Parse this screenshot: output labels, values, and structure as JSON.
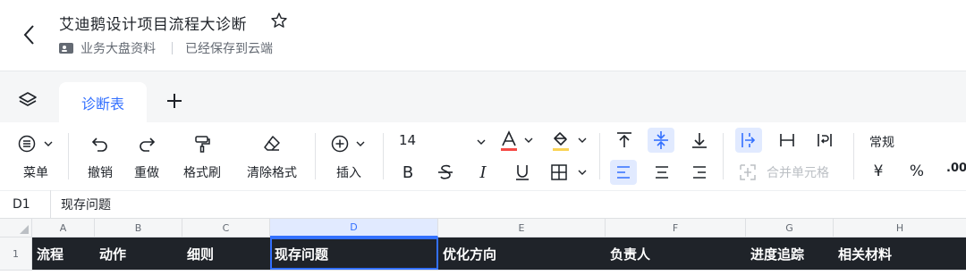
{
  "header": {
    "title": "艾迪鹅设计项目流程大诊断",
    "folder": "业务大盘资料",
    "save_status": "已经保存到云端"
  },
  "tabs": [
    {
      "label": "诊断表",
      "active": true
    }
  ],
  "toolbar": {
    "menu_label": "菜单",
    "undo_label": "撤销",
    "redo_label": "重做",
    "format_painter_label": "格式刷",
    "clear_format_label": "清除格式",
    "insert_label": "插入",
    "font_size": "14",
    "merge_cells_label": "合并单元格",
    "number_format": "常规",
    "currency_symbol": "¥",
    "percent_symbol": "%",
    "decimal_symbol": ".00"
  },
  "formula_bar": {
    "cell_ref": "D1",
    "content": "现存问题"
  },
  "grid": {
    "columns": [
      "A",
      "B",
      "C",
      "D",
      "E",
      "F",
      "G",
      "H"
    ],
    "selected_column": "D",
    "row_numbers": [
      "1"
    ],
    "row1": [
      "流程",
      "动作",
      "细则",
      "现存问题",
      "优化方向",
      "负责人",
      "进度追踪",
      "相关材料"
    ]
  },
  "colors": {
    "accent": "#3370ff",
    "header_row_bg": "#1f2329",
    "font_color_swatch": "#f54a45",
    "fill_color_swatch": "#fad355"
  }
}
